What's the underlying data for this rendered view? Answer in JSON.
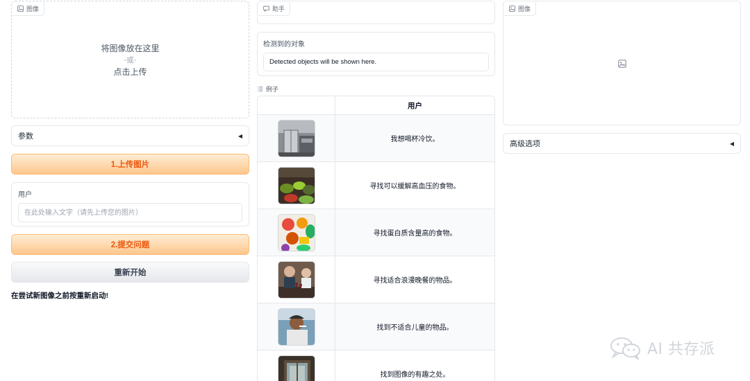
{
  "left": {
    "image_tag": "图像",
    "drop_main": "将图像放在这里",
    "drop_or": "-或-",
    "drop_click": "点击上传",
    "params_label": "参数",
    "upload_button": "1.上传图片",
    "user_label": "用户",
    "user_placeholder": "在此处输入文字（请先上传您的图片）",
    "submit_button": "2.提交问题",
    "restart_button": "重新开始",
    "note": "在尝试新图像之前按重新启动!"
  },
  "middle": {
    "assistant_tag": "助手",
    "detected_label": "检测到的对象",
    "detected_value": "Detected objects will be shown here.",
    "examples_label": "例子",
    "examples_header": "用户",
    "examples": [
      {
        "text": "我想喝杯冷饮。",
        "thumb": "kitchen-fridge"
      },
      {
        "text": "寻找可以缓解高血压的食物。",
        "thumb": "vegetable-market"
      },
      {
        "text": "寻找蛋白质含量高的食物。",
        "thumb": "food-assortment"
      },
      {
        "text": "寻找适合浪漫晚餐的物品。",
        "thumb": "dinner-wine"
      },
      {
        "text": "找到不适合儿童的物品。",
        "thumb": "man-smoking"
      },
      {
        "text": "找到图像的有趣之处。",
        "thumb": "window-frame"
      }
    ]
  },
  "right": {
    "image_tag": "图像",
    "advanced_label": "高级选项"
  },
  "watermark": "AI 共存派",
  "colors": {
    "accent_orange": "#ea580c",
    "button_gradient_top": "#ffedd5",
    "button_gradient_bottom": "#fdc68c",
    "border": "#e5e7eb"
  },
  "icons": [
    "image-icon",
    "chat-icon",
    "list-icon",
    "triangle-left-icon",
    "wechat-icon"
  ]
}
